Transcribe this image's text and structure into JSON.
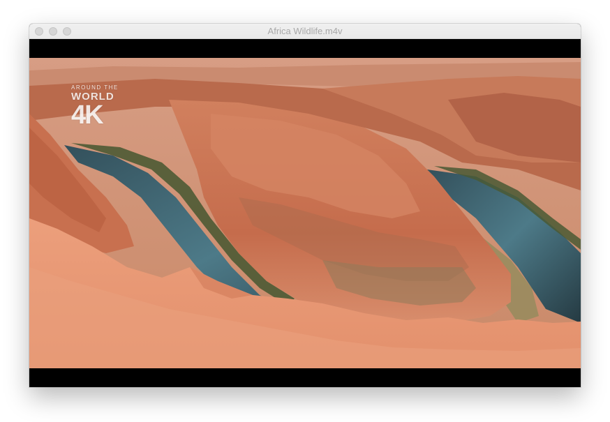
{
  "window": {
    "title": "Africa Wildlife.m4v",
    "controls": [
      "close-button",
      "minimize-button",
      "zoom-button"
    ]
  },
  "video": {
    "watermark": {
      "line1": "AROUND THE",
      "line2": "WORLD",
      "line3": "4K"
    }
  }
}
